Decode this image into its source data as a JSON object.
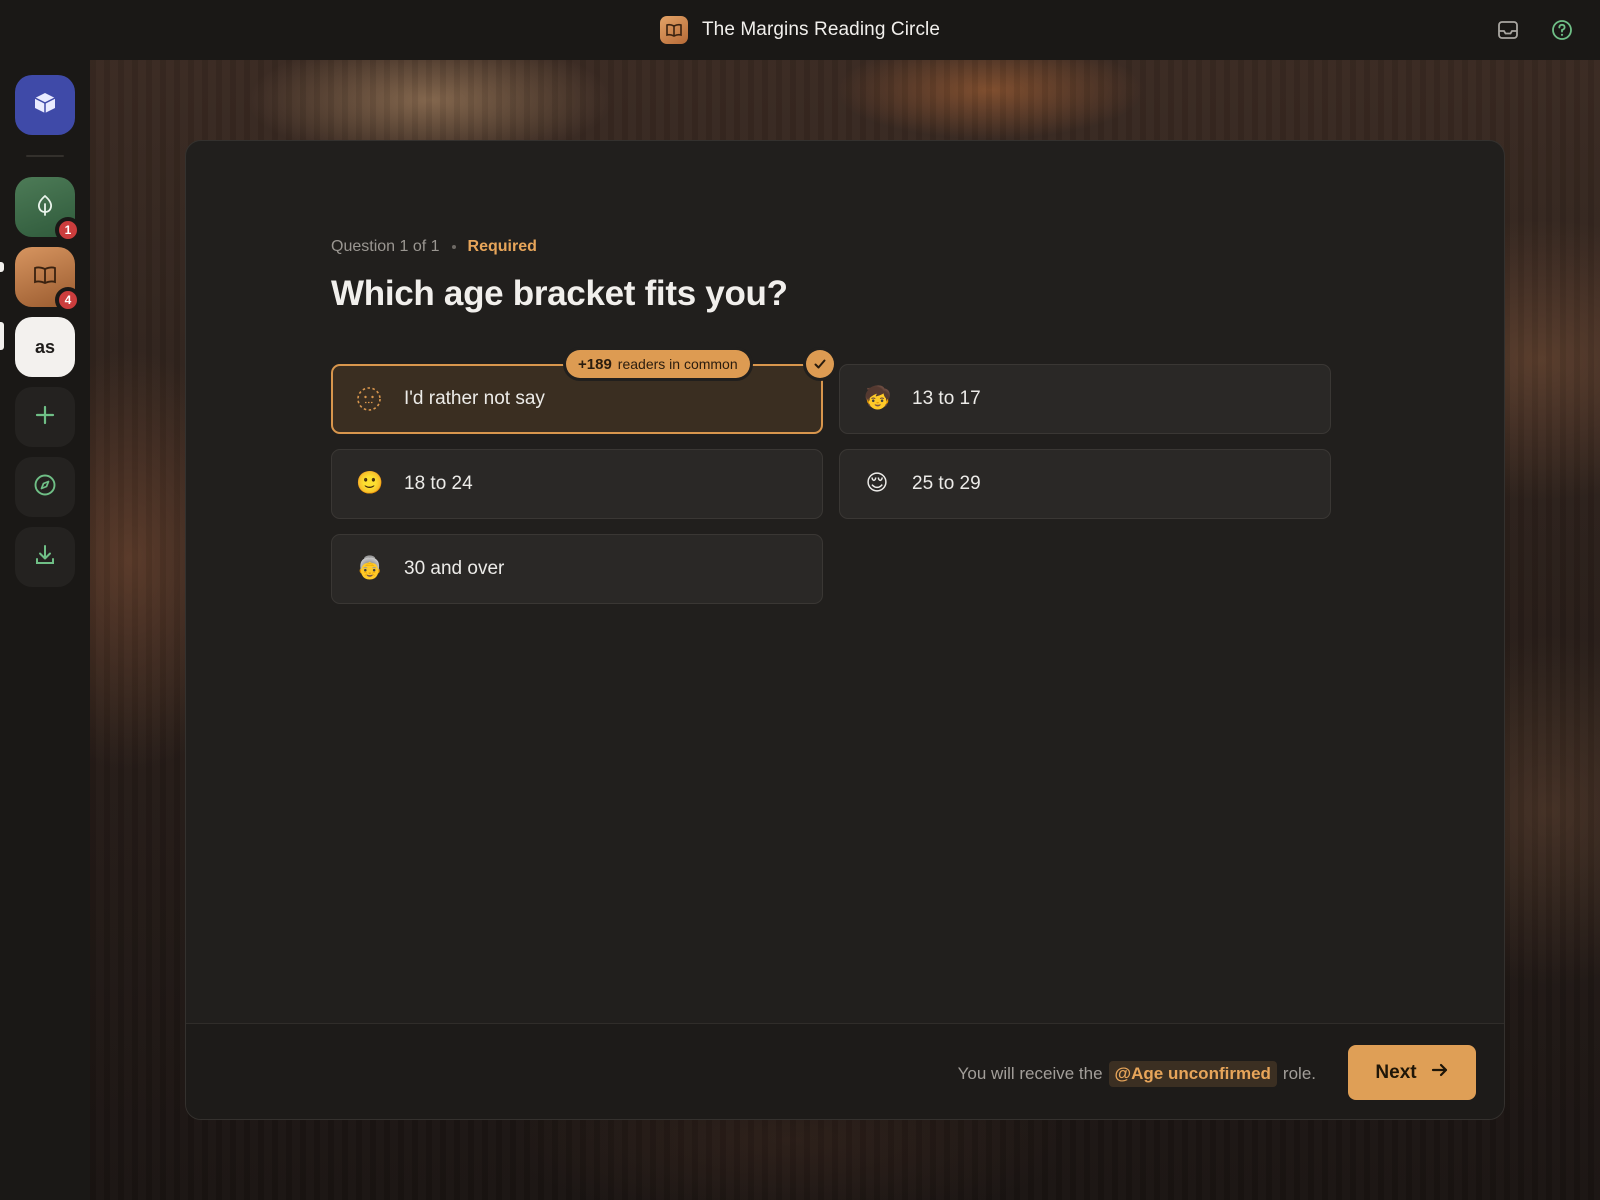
{
  "app": {
    "server_title": "The Margins Reading Circle"
  },
  "rail": {
    "as_label": "as",
    "badges": {
      "green": "1",
      "book": "4"
    }
  },
  "onboarding": {
    "question_counter": "Question 1 of 1",
    "required_label": "Required",
    "question": "Which age bracket fits you?",
    "common_count": "+189",
    "common_text": "readers in common",
    "options": [
      {
        "label": "I'd rather not say",
        "emoji": "🫥",
        "selected": true
      },
      {
        "label": "13 to 17",
        "emoji": "🧒",
        "selected": false
      },
      {
        "label": "18 to 24",
        "emoji": "🙂",
        "selected": false
      },
      {
        "label": "25 to 29",
        "emoji": "😌",
        "selected": false
      },
      {
        "label": "30 and over",
        "emoji": "👵",
        "selected": false
      }
    ],
    "footer": {
      "role_prefix": "You will receive the",
      "role_name": "@Age unconfirmed",
      "role_suffix": "role.",
      "next_label": "Next"
    }
  },
  "colors": {
    "accent": "#df9f56",
    "badge_red": "#cc3d3d",
    "home_blue": "#3f4aa8"
  },
  "icons": {
    "topbar_server": "book-open-icon",
    "topbar_right": [
      "inbox-icon",
      "help-icon"
    ],
    "rail": [
      "home-cube-icon",
      "leaf-icon",
      "book-icon",
      "plus-icon",
      "compass-icon",
      "download-icon"
    ],
    "check": "check-icon",
    "next": "arrow-right-icon"
  }
}
